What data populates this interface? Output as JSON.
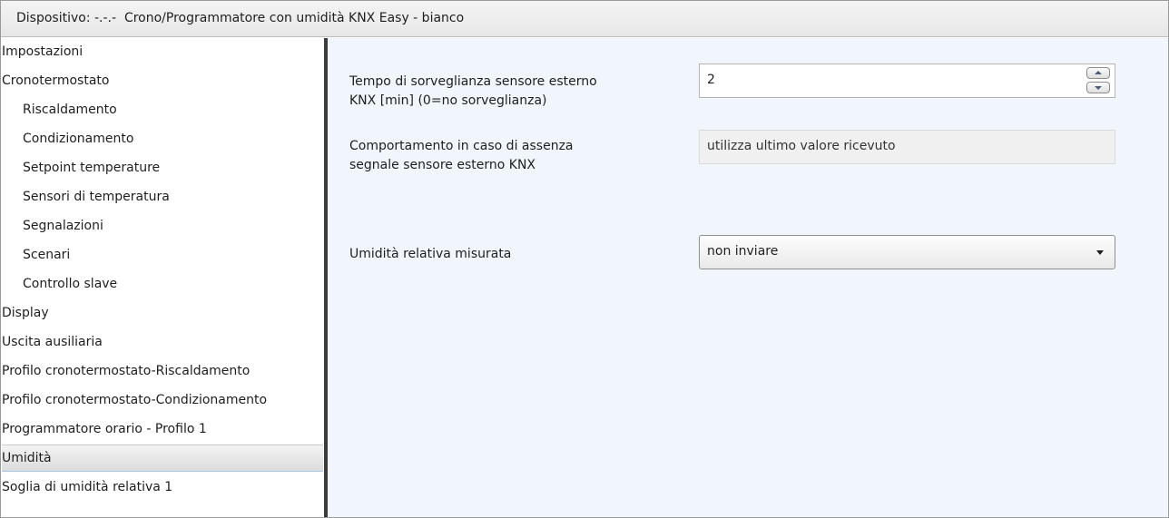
{
  "window": {
    "title": "Dispositivo: -.-.-  Crono/Programmatore con umidità KNX Easy - bianco"
  },
  "sidebar": {
    "items": [
      {
        "label": "Impostazioni"
      },
      {
        "label": "Cronotermostato"
      },
      {
        "label": "Riscaldamento"
      },
      {
        "label": "Condizionamento"
      },
      {
        "label": "Setpoint temperature"
      },
      {
        "label": "Sensori di temperatura"
      },
      {
        "label": "Segnalazioni"
      },
      {
        "label": "Scenari"
      },
      {
        "label": "Controllo slave"
      },
      {
        "label": "Display"
      },
      {
        "label": "Uscita ausiliaria"
      },
      {
        "label": "Profilo cronotermostato-Riscaldamento"
      },
      {
        "label": "Profilo cronotermostato-Condizionamento"
      },
      {
        "label": "Programmatore orario - Profilo 1"
      },
      {
        "label": "Umidità"
      },
      {
        "label": "Soglia di umidità relativa 1"
      }
    ],
    "selected": "Umidità"
  },
  "parameters": {
    "surveillance": {
      "label_line1": "Tempo di sorveglianza sensore esterno",
      "label_line2": "KNX [min] (0=no sorveglianza)",
      "value": "2"
    },
    "absence_behavior": {
      "label_line1": "Comportamento in caso di assenza",
      "label_line2": "segnale sensore esterno KNX",
      "value": "utilizza ultimo valore ricevuto"
    },
    "humidity": {
      "label": "Umidità relativa misurata",
      "value": "non inviare"
    }
  },
  "icons": {
    "spin_up": "arrow-up-icon",
    "spin_down": "arrow-down-icon",
    "dropdown": "chevron-down-icon"
  }
}
